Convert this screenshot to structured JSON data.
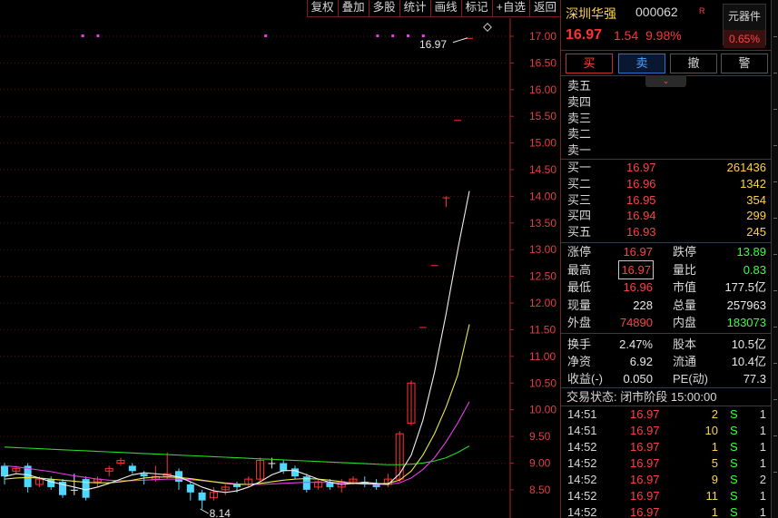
{
  "toolbar": {
    "buttons": [
      "复权",
      "叠加",
      "多股",
      "统计",
      "画线",
      "标记",
      "+自选",
      "返回"
    ]
  },
  "stock": {
    "name": "深圳华强",
    "code": "000062",
    "flag": "R",
    "price": "16.97",
    "change": "1.54",
    "change_pct": "9.98%",
    "sector_name": "元器件",
    "sector_pct": "0.65%"
  },
  "trade_buttons": {
    "buy": "买",
    "sell": "卖",
    "cancel": "撤",
    "alert": "警"
  },
  "sell_book": [
    {
      "label": "卖五",
      "price": "",
      "vol": ""
    },
    {
      "label": "卖四",
      "price": "",
      "vol": ""
    },
    {
      "label": "卖三",
      "price": "",
      "vol": ""
    },
    {
      "label": "卖二",
      "price": "",
      "vol": ""
    },
    {
      "label": "卖一",
      "price": "",
      "vol": ""
    }
  ],
  "buy_book": [
    {
      "label": "买一",
      "price": "16.97",
      "vol": "261436"
    },
    {
      "label": "买二",
      "price": "16.96",
      "vol": "1342"
    },
    {
      "label": "买三",
      "price": "16.95",
      "vol": "354"
    },
    {
      "label": "买四",
      "price": "16.94",
      "vol": "299"
    },
    {
      "label": "买五",
      "price": "16.93",
      "vol": "245"
    }
  ],
  "quote": {
    "limit_up_label": "涨停",
    "limit_up": "16.97",
    "limit_down_label": "跌停",
    "limit_down": "13.89",
    "high_label": "最高",
    "high": "16.97",
    "vol_ratio_label": "量比",
    "vol_ratio": "0.83",
    "low_label": "最低",
    "low": "16.96",
    "mkt_cap_label": "市值",
    "mkt_cap": "177.5亿",
    "cur_vol_label": "现量",
    "cur_vol": "228",
    "total_vol_label": "总量",
    "total_vol": "257963",
    "outer_label": "外盘",
    "outer": "74890",
    "inner_label": "内盘",
    "inner": "183073"
  },
  "fund": {
    "turnover_label": "换手",
    "turnover": "2.47%",
    "shares_label": "股本",
    "shares": "10.5亿",
    "nav_label": "净资",
    "nav": "6.92",
    "float_label": "流通",
    "float": "10.4亿",
    "eps_label": "收益(-)",
    "eps": "0.050",
    "pe_label": "PE(动)",
    "pe": "77.3"
  },
  "trade_status": "交易状态: 闭市阶段 15:00:00",
  "ticks": [
    {
      "time": "14:51",
      "price": "16.97",
      "vol": "2",
      "side": "S",
      "count": "1"
    },
    {
      "time": "14:51",
      "price": "16.97",
      "vol": "10",
      "side": "S",
      "count": "1"
    },
    {
      "time": "14:52",
      "price": "16.97",
      "vol": "1",
      "side": "S",
      "count": "1"
    },
    {
      "time": "14:52",
      "price": "16.97",
      "vol": "5",
      "side": "S",
      "count": "1"
    },
    {
      "time": "14:52",
      "price": "16.97",
      "vol": "9",
      "side": "S",
      "count": "2"
    },
    {
      "time": "14:52",
      "price": "16.97",
      "vol": "11",
      "side": "S",
      "count": "1"
    },
    {
      "time": "14:52",
      "price": "16.97",
      "vol": "1",
      "side": "S",
      "count": "1"
    }
  ],
  "chart_data": {
    "type": "candlestick",
    "y_ticks": [
      "17.00",
      "16.50",
      "16.00",
      "15.50",
      "15.00",
      "14.50",
      "14.00",
      "13.50",
      "13.00",
      "12.50",
      "12.00",
      "11.50",
      "11.00",
      "10.50",
      "10.00",
      "9.50",
      "9.00",
      "8.50"
    ],
    "ylim": [
      8.2,
      17.4
    ],
    "max_label": "16.97",
    "min_label": "8.14",
    "candles": [
      {
        "o": 8.95,
        "c": 8.75,
        "h": 9.0,
        "l": 8.6
      },
      {
        "o": 8.85,
        "c": 8.9,
        "h": 8.95,
        "l": 8.8
      },
      {
        "o": 8.95,
        "c": 8.55,
        "h": 9.0,
        "l": 8.45
      },
      {
        "o": 8.6,
        "c": 8.7,
        "h": 8.75,
        "l": 8.55
      },
      {
        "o": 8.7,
        "c": 8.55,
        "h": 8.75,
        "l": 8.5
      },
      {
        "o": 8.65,
        "c": 8.4,
        "h": 8.7,
        "l": 8.35
      },
      {
        "o": 8.5,
        "c": 8.5,
        "h": 8.8,
        "l": 8.4
      },
      {
        "o": 8.7,
        "c": 8.35,
        "h": 8.75,
        "l": 8.3
      },
      {
        "o": 8.65,
        "c": 8.7,
        "h": 8.75,
        "l": 8.55
      },
      {
        "o": 8.85,
        "c": 8.9,
        "h": 8.95,
        "l": 8.75
      },
      {
        "o": 9.0,
        "c": 9.05,
        "h": 9.1,
        "l": 8.95
      },
      {
        "o": 8.95,
        "c": 8.85,
        "h": 9.0,
        "l": 8.8
      },
      {
        "o": 8.8,
        "c": 8.75,
        "h": 8.85,
        "l": 8.6
      },
      {
        "o": 8.7,
        "c": 8.75,
        "h": 8.95,
        "l": 8.65
      },
      {
        "o": 8.75,
        "c": 8.8,
        "h": 9.2,
        "l": 8.7
      },
      {
        "o": 8.85,
        "c": 8.65,
        "h": 8.9,
        "l": 8.5
      },
      {
        "o": 8.6,
        "c": 8.45,
        "h": 8.65,
        "l": 8.3
      },
      {
        "o": 8.45,
        "c": 8.3,
        "h": 8.5,
        "l": 8.14
      },
      {
        "o": 8.35,
        "c": 8.45,
        "h": 8.55,
        "l": 8.3
      },
      {
        "o": 8.5,
        "c": 8.55,
        "h": 8.6,
        "l": 8.4
      },
      {
        "o": 8.6,
        "c": 8.55,
        "h": 8.65,
        "l": 8.45
      },
      {
        "o": 8.6,
        "c": 8.7,
        "h": 8.75,
        "l": 8.55
      },
      {
        "o": 8.7,
        "c": 9.05,
        "h": 9.1,
        "l": 8.65
      },
      {
        "o": 9.0,
        "c": 9.0,
        "h": 9.1,
        "l": 8.9
      },
      {
        "o": 9.0,
        "c": 8.85,
        "h": 9.05,
        "l": 8.8
      },
      {
        "o": 8.9,
        "c": 8.75,
        "h": 8.95,
        "l": 8.7
      },
      {
        "o": 8.75,
        "c": 8.5,
        "h": 8.8,
        "l": 8.45
      },
      {
        "o": 8.55,
        "c": 8.65,
        "h": 8.7,
        "l": 8.5
      },
      {
        "o": 8.65,
        "c": 8.55,
        "h": 8.7,
        "l": 8.5
      },
      {
        "o": 8.55,
        "c": 8.65,
        "h": 8.7,
        "l": 8.45
      },
      {
        "o": 8.65,
        "c": 8.7,
        "h": 8.75,
        "l": 8.6
      },
      {
        "o": 8.65,
        "c": 8.6,
        "h": 8.75,
        "l": 8.55
      },
      {
        "o": 8.6,
        "c": 8.55,
        "h": 8.7,
        "l": 8.5
      },
      {
        "o": 8.6,
        "c": 8.7,
        "h": 8.8,
        "l": 8.55
      },
      {
        "o": 8.7,
        "c": 9.55,
        "h": 9.6,
        "l": 8.65
      },
      {
        "o": 9.75,
        "c": 10.5,
        "h": 10.55,
        "l": 9.7
      },
      {
        "o": 11.55,
        "c": 11.55,
        "h": 11.55,
        "l": 11.55
      },
      {
        "o": 12.71,
        "c": 12.71,
        "h": 12.71,
        "l": 12.71
      },
      {
        "o": 13.98,
        "c": 13.98,
        "h": 14.0,
        "l": 13.8
      },
      {
        "o": 15.43,
        "c": 15.43,
        "h": 15.43,
        "l": 15.43
      },
      {
        "o": 16.97,
        "c": 16.97,
        "h": 16.97,
        "l": 16.97
      }
    ],
    "ma_white": [
      8.75,
      8.8,
      8.78,
      8.72,
      8.65,
      8.6,
      8.55,
      8.5,
      8.55,
      8.62,
      8.7,
      8.78,
      8.82,
      8.8,
      8.78,
      8.74,
      8.65,
      8.55,
      8.48,
      8.45,
      8.48,
      8.55,
      8.65,
      8.78,
      8.86,
      8.86,
      8.78,
      8.7,
      8.64,
      8.6,
      8.62,
      8.64,
      8.62,
      8.6,
      8.8,
      9.15,
      9.8,
      10.7,
      11.8,
      13.0,
      14.1
    ],
    "ma_yellow": [
      8.7,
      8.72,
      8.73,
      8.72,
      8.7,
      8.68,
      8.66,
      8.64,
      8.63,
      8.63,
      8.65,
      8.68,
      8.72,
      8.74,
      8.74,
      8.73,
      8.71,
      8.68,
      8.65,
      8.62,
      8.6,
      8.6,
      8.62,
      8.65,
      8.68,
      8.7,
      8.71,
      8.7,
      8.68,
      8.65,
      8.62,
      8.61,
      8.61,
      8.62,
      8.68,
      8.85,
      9.15,
      9.55,
      10.05,
      10.65,
      11.6
    ],
    "ma_magenta": [
      8.95,
      8.93,
      8.9,
      8.87,
      8.84,
      8.8,
      8.76,
      8.73,
      8.7,
      8.68,
      8.67,
      8.67,
      8.68,
      8.69,
      8.7,
      8.7,
      8.69,
      8.67,
      8.65,
      8.63,
      8.61,
      8.6,
      8.6,
      8.61,
      8.62,
      8.63,
      8.64,
      8.64,
      8.64,
      8.63,
      8.62,
      8.61,
      8.6,
      8.6,
      8.63,
      8.72,
      8.88,
      9.1,
      9.4,
      9.75,
      10.15
    ],
    "ma_green": [
      9.3,
      9.29,
      9.28,
      9.27,
      9.26,
      9.25,
      9.24,
      9.23,
      9.22,
      9.21,
      9.2,
      9.19,
      9.18,
      9.17,
      9.16,
      9.15,
      9.14,
      9.13,
      9.12,
      9.11,
      9.1,
      9.09,
      9.08,
      9.07,
      9.06,
      9.05,
      9.04,
      9.03,
      9.02,
      9.01,
      9.0,
      8.99,
      8.98,
      8.97,
      8.97,
      8.98,
      9.0,
      9.04,
      9.1,
      9.2,
      9.32
    ],
    "limit_markers": [
      0.16,
      0.19,
      0.52,
      0.74,
      0.77,
      0.8,
      0.83
    ]
  }
}
